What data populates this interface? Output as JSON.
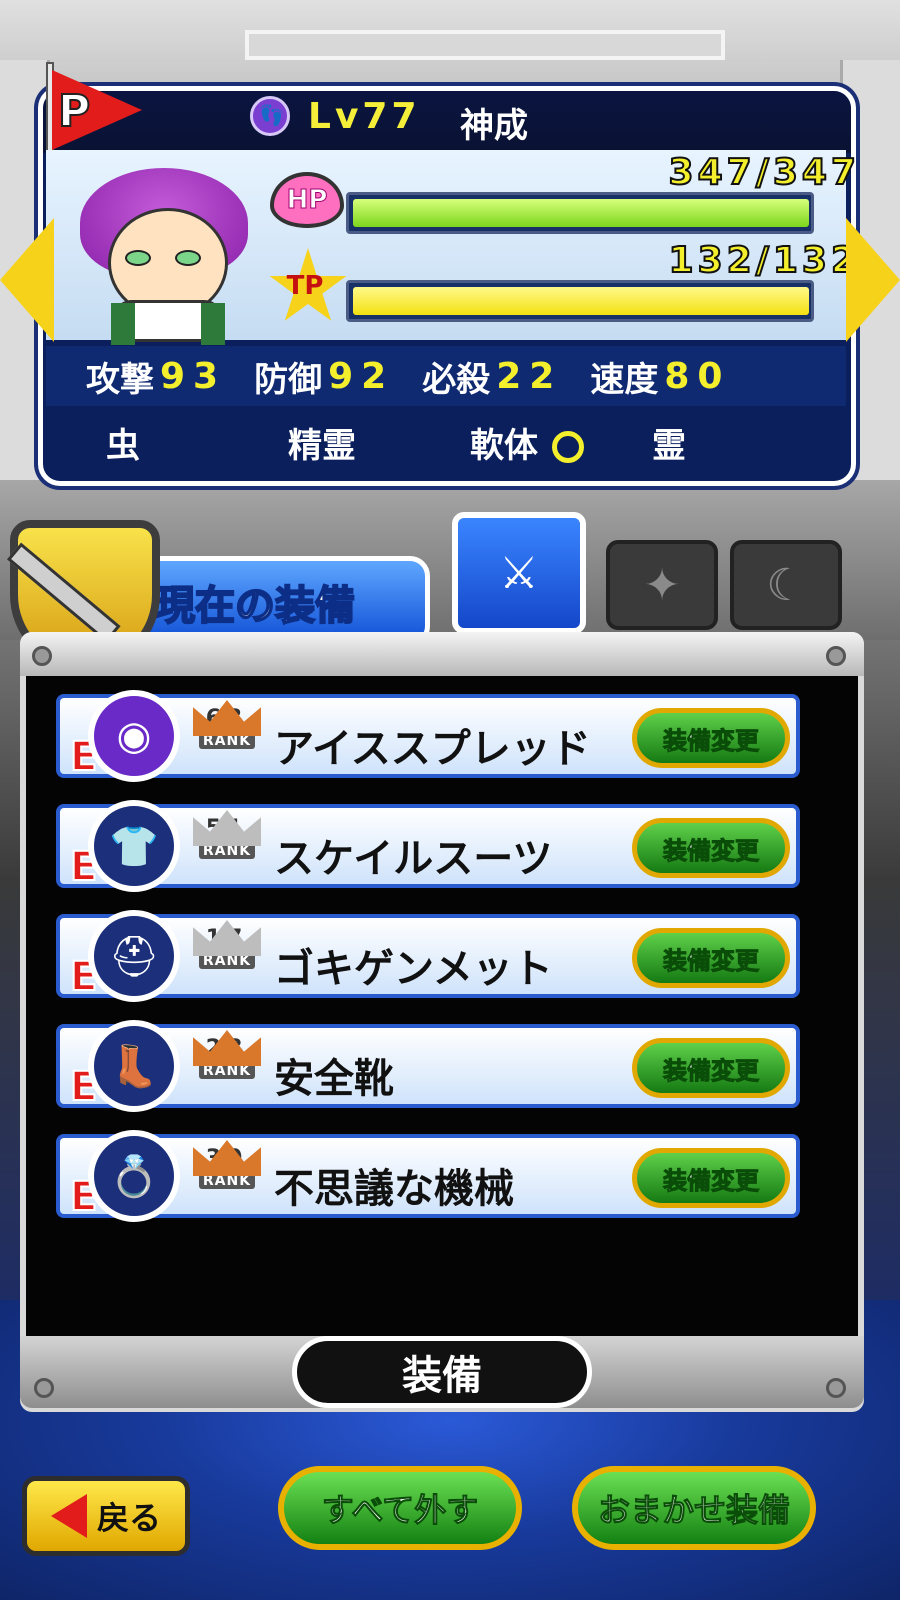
{
  "character": {
    "flag_letter": "P",
    "level": "Lv77",
    "name": "神成",
    "hp": "347/347",
    "tp": "132/132",
    "hp_fraction": 1.0,
    "tp_fraction": 1.0,
    "hp_label": "HP",
    "tp_label": "TP",
    "stats": [
      {
        "label": "攻撃",
        "value": "93"
      },
      {
        "label": "防御",
        "value": "92"
      },
      {
        "label": "必殺",
        "value": "22"
      },
      {
        "label": "速度",
        "value": "80"
      }
    ],
    "types": [
      "虫",
      "精霊",
      "軟体",
      "霊"
    ]
  },
  "equip_header": {
    "title": "現在の装備"
  },
  "equipment": [
    {
      "slot": "E",
      "rank": "63",
      "rank_label": "RANK",
      "name": "アイススプレッド",
      "button": "装備変更",
      "crown_color": "#d9782a",
      "slot_color": "#6a2ac8"
    },
    {
      "slot": "E",
      "rank": "51",
      "rank_label": "RANK",
      "name": "スケイルスーツ",
      "button": "装備変更",
      "crown_color": "#bdbdbd",
      "slot_color": "#1b2f7a"
    },
    {
      "slot": "E",
      "rank": "17",
      "rank_label": "RANK",
      "name": "ゴキゲンメット",
      "button": "装備変更",
      "crown_color": "#bdbdbd",
      "slot_color": "#1b2f7a"
    },
    {
      "slot": "E",
      "rank": "28",
      "rank_label": "RANK",
      "name": "安全靴",
      "button": "装備変更",
      "crown_color": "#d9782a",
      "slot_color": "#1b2f7a"
    },
    {
      "slot": "E",
      "rank": "30",
      "rank_label": "RANK",
      "name": "不思議な機械",
      "button": "装備変更",
      "crown_color": "#d9782a",
      "slot_color": "#1b2f7a"
    }
  ],
  "buttons": {
    "equip": "装備",
    "back": "戻る",
    "unequip_all": "すべて外す",
    "auto_equip": "おまかせ装備"
  }
}
